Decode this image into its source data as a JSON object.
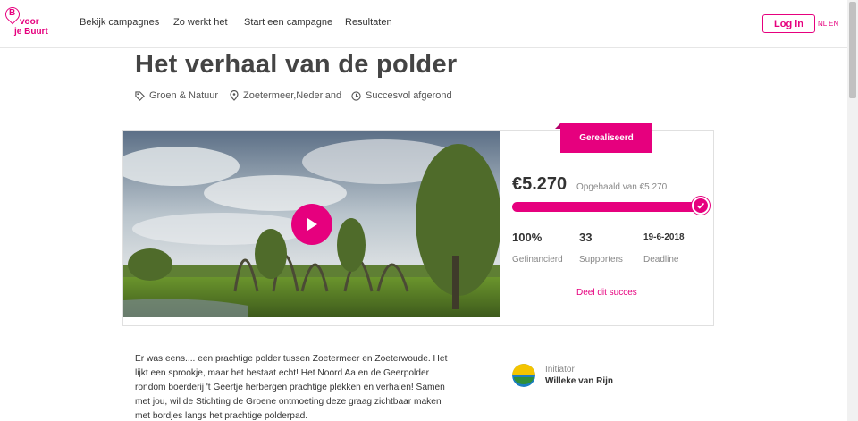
{
  "header": {
    "logo": {
      "line1": "voor",
      "line2": "je Buurt",
      "mark": "B"
    },
    "nav": [
      "Bekijk campagnes",
      "Zo werkt het",
      "Start een campagne",
      "Resultaten"
    ],
    "login_label": "Log in",
    "lang_nl": "NL",
    "lang_en": "EN"
  },
  "campaign": {
    "title": "Het verhaal van de polder",
    "category": "Groen & Natuur",
    "location": "Zoetermeer,Nederland",
    "status": "Succesvol afgerond",
    "badge": "Gerealiseerd",
    "raised": "€5.270",
    "raised_of": "Opgehaald van €5.270",
    "progress_fraction": 1.0,
    "stats": {
      "percent": "100%",
      "percent_label": "Gefinancierd",
      "supporters": "33",
      "supporters_label": "Supporters",
      "deadline": "19-6-2018",
      "deadline_label": "Deadline"
    },
    "share_label": "Deel dit succes",
    "description": "Er was eens.... een prachtige polder tussen Zoetermeer en Zoeterwoude. Het lijkt een sprookje, maar het bestaat echt! Het Noord Aa en de Geerpolder rondom boerderij 't Geertje herbergen prachtige plekken en verhalen! Samen met jou, wil de Stichting de Groene ontmoeting deze graag zichtbaar maken met bordjes langs het prachtige polderpad.",
    "initiator_label": "Initiator",
    "initiator_name": "Willeke van Rijn"
  },
  "colors": {
    "accent": "#e6007e",
    "text": "#333333",
    "muted": "#888888"
  },
  "icons": {
    "category": "tag-icon",
    "location": "map-pin-icon",
    "status": "clock-icon",
    "video": "play-icon",
    "progress_done": "check-icon"
  }
}
